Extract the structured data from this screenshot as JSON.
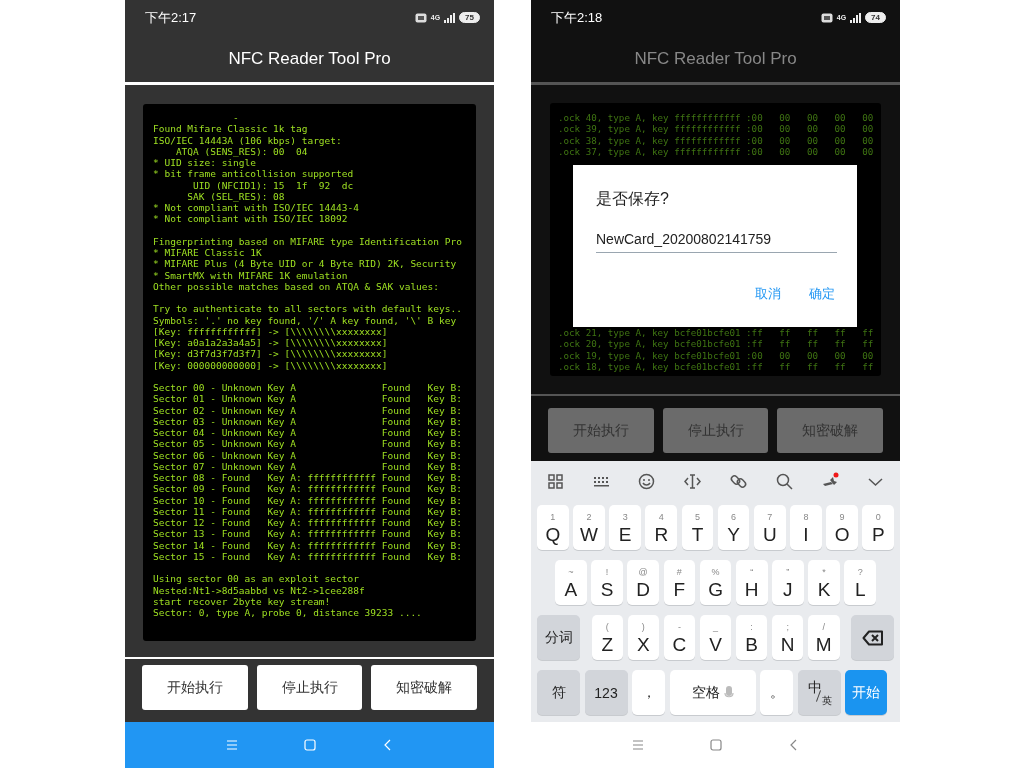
{
  "screens": [
    {
      "kind": "log",
      "status_bar": {
        "time": "下午2:17",
        "network": "4G",
        "battery": "75"
      },
      "title": "NFC Reader Tool Pro",
      "log": {
        "blocks": [
          [
            "              -",
            "Found Mifare Classic 1k tag",
            "ISO/IEC 14443A (106 kbps) target:",
            "    ATQA (SENS_RES): 00  04",
            "* UID size: single",
            "* bit frame anticollision supported",
            "       UID (NFCID1): 15  1f  92  dc",
            "      SAK (SEL_RES): 08",
            "* Not compliant with ISO/IEC 14443-4",
            "* Not compliant with ISO/IEC 18092"
          ],
          [
            "Fingerprinting based on MIFARE type Identification Pro",
            "* MIFARE Classic 1K",
            "* MIFARE Plus (4 Byte UID or 4 Byte RID) 2K, Security",
            "* SmartMX with MIFARE 1K emulation",
            "Other possible matches based on ATQA & SAK values:"
          ],
          [
            "Try to authenticate to all sectors with default keys..",
            "Symbols: '.' no key found, '/' A key found, '\\' B key",
            "[Key: ffffffffffff] -> [\\\\\\\\\\\\\\\\xxxxxxxx]",
            "[Key: a0a1a2a3a4a5] -> [\\\\\\\\\\\\\\\\xxxxxxxx]",
            "[Key: d3f7d3f7d3f7] -> [\\\\\\\\\\\\\\\\xxxxxxxx]",
            "[Key: 000000000000] -> [\\\\\\\\\\\\\\\\xxxxxxxx]"
          ],
          [
            "Sector 00 - Unknown Key A               Found   Key B:",
            "Sector 01 - Unknown Key A               Found   Key B:",
            "Sector 02 - Unknown Key A               Found   Key B:",
            "Sector 03 - Unknown Key A               Found   Key B:",
            "Sector 04 - Unknown Key A               Found   Key B:",
            "Sector 05 - Unknown Key A               Found   Key B:",
            "Sector 06 - Unknown Key A               Found   Key B:",
            "Sector 07 - Unknown Key A               Found   Key B:",
            "Sector 08 - Found   Key A: ffffffffffff Found   Key B:",
            "Sector 09 - Found   Key A: ffffffffffff Found   Key B:",
            "Sector 10 - Found   Key A: ffffffffffff Found   Key B:",
            "Sector 11 - Found   Key A: ffffffffffff Found   Key B:",
            "Sector 12 - Found   Key A: ffffffffffff Found   Key B:",
            "Sector 13 - Found   Key A: ffffffffffff Found   Key B:",
            "Sector 14 - Found   Key A: ffffffffffff Found   Key B:",
            "Sector 15 - Found   Key A: ffffffffffff Found   Key B:"
          ],
          [
            "Using sector 00 as an exploit sector",
            "Nested:Nt1->8d5aabbd vs Nt2->1cee288f",
            "start recover 2byte key stream!",
            "Sector: 0, type A, probe 0, distance 39233 ...."
          ]
        ]
      },
      "buttons": [
        "开始执行",
        "停止执行",
        "知密破解"
      ]
    },
    {
      "kind": "save_dialog",
      "status_bar": {
        "time": "下午2:18",
        "network": "4G",
        "battery": "74"
      },
      "title": "NFC Reader Tool Pro",
      "log": {
        "blocks": [
          [
            ".ock 40, type A, key ffffffffffff :00   00   00   00   00",
            ".ock 39, type A, key ffffffffffff :00   00   00   00   00",
            ".ock 38, type A, key ffffffffffff :00   00   00   00   00",
            ".ock 37, type A, key ffffffffffff :00   00   00   00   00"
          ],
          [
            ".ock 21, type A, key bcfe01bcfe01 :ff   ff   ff   ff   ff",
            ".ock 20, type A, key bcfe01bcfe01 :ff   ff   ff   ff   ff",
            ".ock 19, type A, key bcfe01bcfe01 :00   00   00   00   00",
            ".ock 18, type A, key bcfe01bcfe01 :ff   ff   ff   ff   ff"
          ]
        ]
      },
      "buttons": [
        "开始执行",
        "停止执行",
        "知密破解"
      ],
      "dialog": {
        "title": "是否保存?",
        "value": "NewCard_20200802141759",
        "actions": [
          "取消",
          "确定"
        ]
      },
      "keyboard": {
        "rows": [
          {
            "keys": [
              {
                "kind": "letter",
                "label": "Q",
                "hint": "1"
              },
              {
                "kind": "letter",
                "label": "W",
                "hint": "2"
              },
              {
                "kind": "letter",
                "label": "E",
                "hint": "3"
              },
              {
                "kind": "letter",
                "label": "R",
                "hint": "4"
              },
              {
                "kind": "letter",
                "label": "T",
                "hint": "5"
              },
              {
                "kind": "letter",
                "label": "Y",
                "hint": "6"
              },
              {
                "kind": "letter",
                "label": "U",
                "hint": "7"
              },
              {
                "kind": "letter",
                "label": "I",
                "hint": "8"
              },
              {
                "kind": "letter",
                "label": "O",
                "hint": "9"
              },
              {
                "kind": "letter",
                "label": "P",
                "hint": "0"
              }
            ]
          },
          {
            "keys": [
              {
                "kind": "letter",
                "label": "A",
                "hint": "~"
              },
              {
                "kind": "letter",
                "label": "S",
                "hint": "!"
              },
              {
                "kind": "letter",
                "label": "D",
                "hint": "@"
              },
              {
                "kind": "letter",
                "label": "F",
                "hint": "#"
              },
              {
                "kind": "letter",
                "label": "G",
                "hint": "%"
              },
              {
                "kind": "letter",
                "label": "H",
                "hint": "“"
              },
              {
                "kind": "letter",
                "label": "J",
                "hint": "”"
              },
              {
                "kind": "letter",
                "label": "K",
                "hint": "*"
              },
              {
                "kind": "letter",
                "label": "L",
                "hint": "?"
              }
            ]
          },
          {
            "keys": [
              {
                "kind": "function",
                "label": "分词"
              },
              {
                "kind": "letter",
                "label": "Z",
                "hint": "("
              },
              {
                "kind": "letter",
                "label": "X",
                "hint": ")"
              },
              {
                "kind": "letter",
                "label": "C",
                "hint": "-"
              },
              {
                "kind": "letter",
                "label": "V",
                "hint": "_"
              },
              {
                "kind": "letter",
                "label": "B",
                "hint": ":"
              },
              {
                "kind": "letter",
                "label": "N",
                "hint": ";"
              },
              {
                "kind": "letter",
                "label": "M",
                "hint": "/"
              },
              {
                "kind": "backspace"
              }
            ]
          },
          {
            "keys": [
              {
                "kind": "function",
                "label": "符"
              },
              {
                "kind": "function",
                "label": "123"
              },
              {
                "kind": "punct",
                "label": "，"
              },
              {
                "kind": "space",
                "label": "空格"
              },
              {
                "kind": "punct",
                "label": "。"
              },
              {
                "kind": "lang",
                "label": "中",
                "hint": "英"
              },
              {
                "kind": "enter",
                "label": "开始"
              }
            ]
          }
        ]
      }
    }
  ]
}
